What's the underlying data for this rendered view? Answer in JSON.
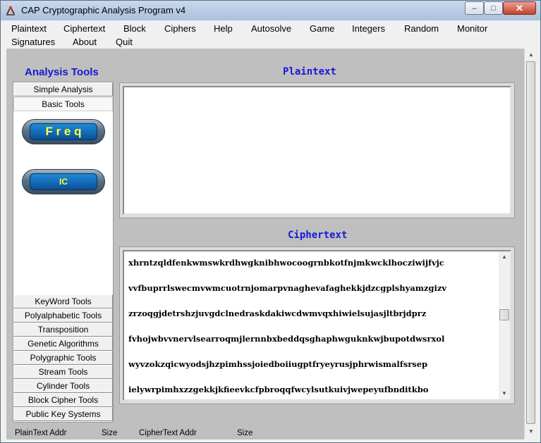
{
  "window": {
    "title": "CAP  Cryptographic Analysis Program v4",
    "min_symbol": "–",
    "max_symbol": "□",
    "close_symbol": "✕"
  },
  "menu": {
    "items": [
      "Plaintext",
      "Ciphertext",
      "Block",
      "Ciphers",
      "Help",
      "Autosolve",
      "Game",
      "Integers",
      "Random",
      "Monitor",
      "Signatures",
      "About",
      "Quit"
    ]
  },
  "sidebar": {
    "title": "Analysis Tools",
    "top_tabs": [
      "Simple Analysis",
      "Basic Tools"
    ],
    "freq_label": "F r e q",
    "ic_label": "IC",
    "bottom_tabs": [
      "KeyWord Tools",
      "Polyalphabetic Tools",
      "Transposition",
      "Genetic Algorithms",
      "Polygraphic Tools",
      "Stream Tools",
      "Cylinder Tools",
      "Block Cipher Tools",
      "Public Key Systems"
    ]
  },
  "plaintext": {
    "title": "Plaintext"
  },
  "ciphertext": {
    "title": "Ciphertext",
    "lines": [
      "xhrntzqldfenkwmswkrdhwgknibhwocoogrnbkotfnjmkwcklhocziwijfvjc",
      "vvfbuprrlswecmvwmcuotrnjomarpvnaghevafaghekkjdzcgplshyamzgizv",
      "zrzoqgjdetrshzjuvgdclnedraskdakiwcdwmvqxhiwielsujasjltbrjdprz",
      "fvhojwbvvnervlsearroqmjlernnbxbeddqsghaphwguknkwjbupotdwsrxol",
      "wyvzokzqicwyodsjhzpimhssjoiedboiiugptfryeyrusjphrwismalfsrsep",
      "ielywrpimhxzzgekkjkfieevkcfpbroqqfwcylsutkuivjwepeyufbnditkbo"
    ]
  },
  "statusbar": {
    "plaintext_addr": "PlainText Addr",
    "size1": "Size",
    "ciphertext_addr": "CipherText Addr",
    "size2": "Size"
  }
}
